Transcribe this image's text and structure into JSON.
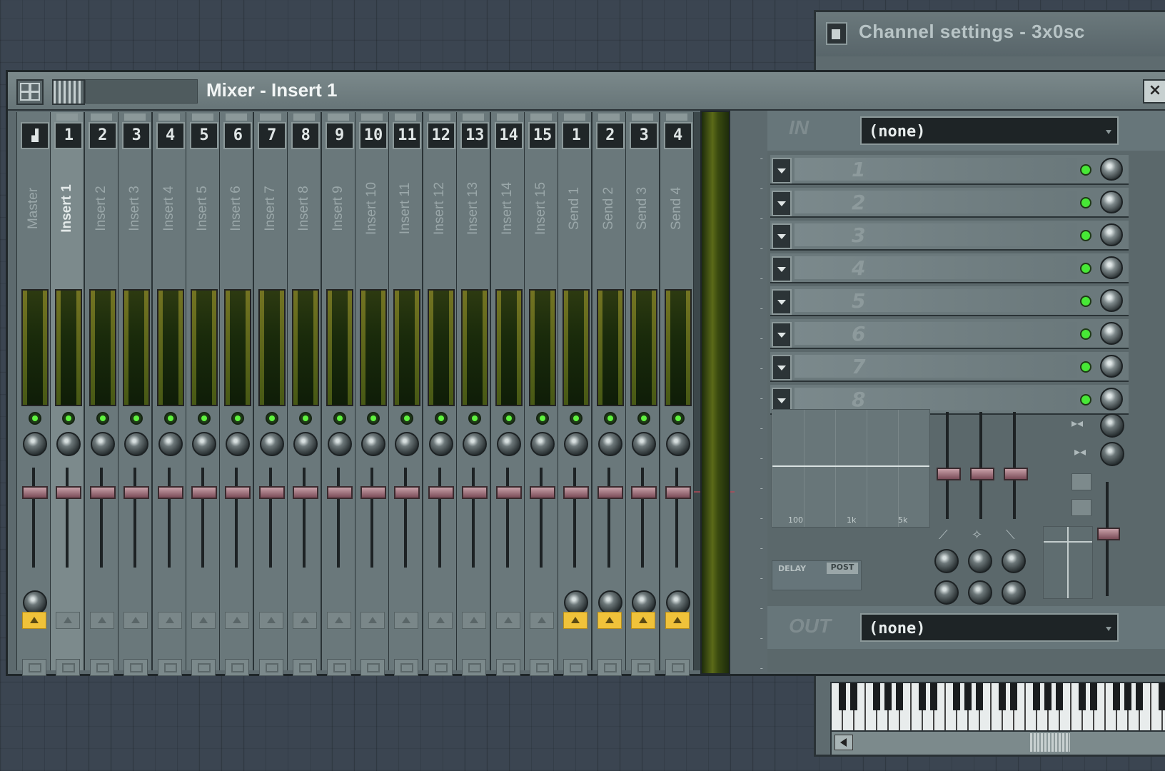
{
  "channel_settings": {
    "title": "Channel settings - 3x0sc"
  },
  "mixer": {
    "title": "Mixer - Insert 1",
    "close_label": "×",
    "selected_index": 1,
    "channels": [
      {
        "num": "",
        "name": "Master",
        "route_on": true
      },
      {
        "num": "1",
        "name": "Insert 1",
        "route_on": false
      },
      {
        "num": "2",
        "name": "Insert 2",
        "route_on": false
      },
      {
        "num": "3",
        "name": "Insert 3",
        "route_on": false
      },
      {
        "num": "4",
        "name": "Insert 4",
        "route_on": false
      },
      {
        "num": "5",
        "name": "Insert 5",
        "route_on": false
      },
      {
        "num": "6",
        "name": "Insert 6",
        "route_on": false
      },
      {
        "num": "7",
        "name": "Insert 7",
        "route_on": false
      },
      {
        "num": "8",
        "name": "Insert 8",
        "route_on": false
      },
      {
        "num": "9",
        "name": "Insert 9",
        "route_on": false
      },
      {
        "num": "10",
        "name": "Insert 10",
        "route_on": false
      },
      {
        "num": "11",
        "name": "Insert 11",
        "route_on": false
      },
      {
        "num": "12",
        "name": "Insert 12",
        "route_on": false
      },
      {
        "num": "13",
        "name": "Insert 13",
        "route_on": false
      },
      {
        "num": "14",
        "name": "Insert 14",
        "route_on": false
      },
      {
        "num": "15",
        "name": "Insert 15",
        "route_on": false
      },
      {
        "num": "1",
        "name": "Send 1",
        "route_on": true
      },
      {
        "num": "2",
        "name": "Send 2",
        "route_on": true
      },
      {
        "num": "3",
        "name": "Send 3",
        "route_on": true
      },
      {
        "num": "4",
        "name": "Send 4",
        "route_on": true
      }
    ]
  },
  "fx_panel": {
    "in_label": "IN",
    "in_value": "(none)",
    "slots": [
      "1",
      "2",
      "3",
      "4",
      "5",
      "6",
      "7",
      "8"
    ],
    "eq_freqs": [
      "100",
      "1k",
      "5k"
    ],
    "delay_label": "DELAY",
    "post_label": "POST",
    "out_label": "OUT",
    "out_value": "(none)"
  },
  "colors": {
    "route_active": "#f0c23a",
    "led_green": "#5ef23e",
    "fader_cap": "#b07884"
  }
}
